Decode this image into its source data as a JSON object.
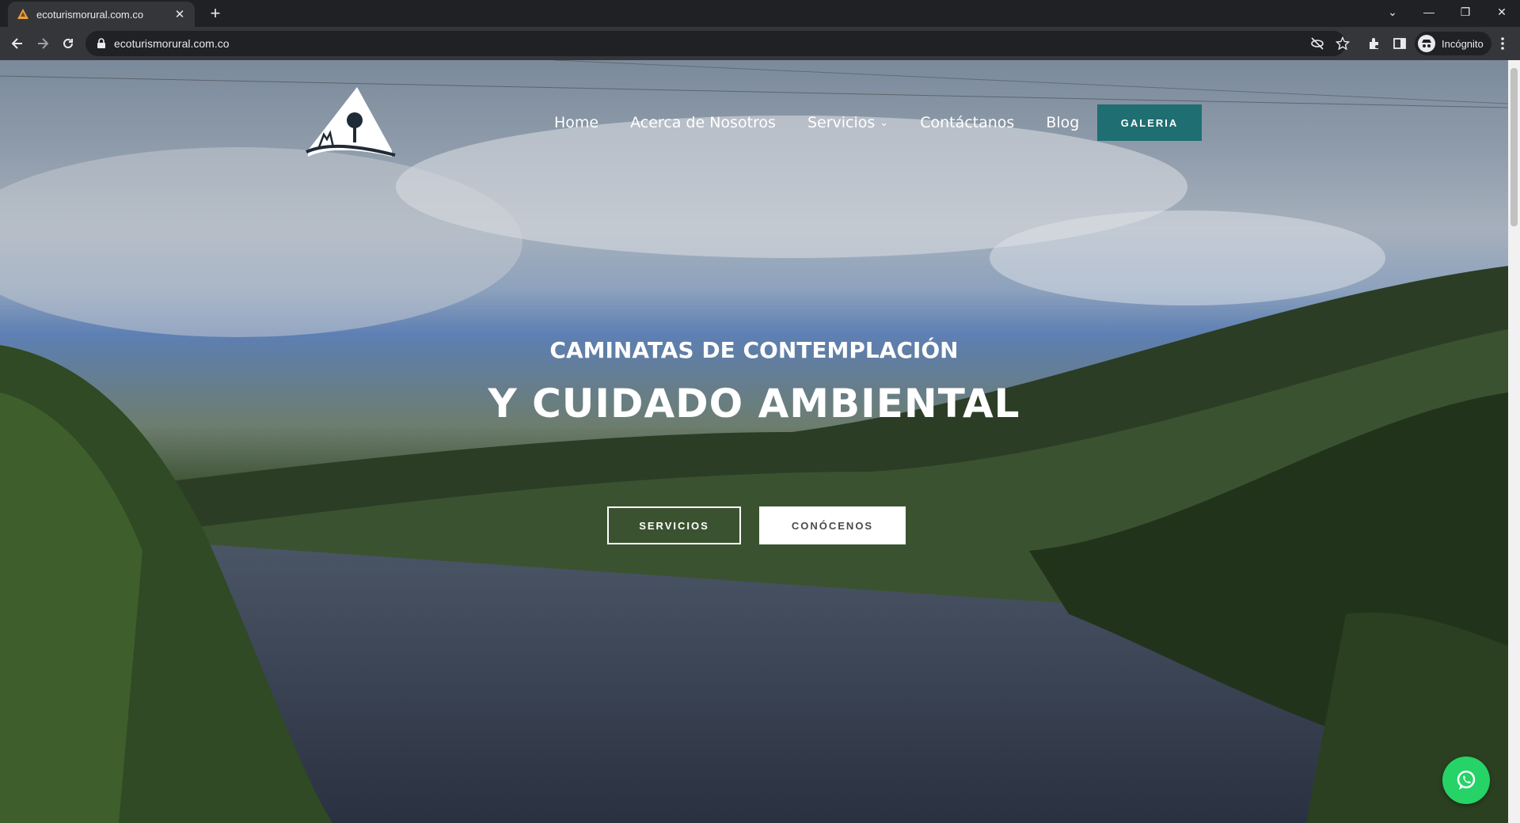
{
  "browser": {
    "tab_title": "ecoturismorural.com.co",
    "url": "ecoturismorural.com.co",
    "profile_label": "Incógnito"
  },
  "site": {
    "nav": {
      "home": "Home",
      "about": "Acerca de Nosotros",
      "services": "Servicios",
      "contact": "Contáctanos",
      "blog": "Blog",
      "gallery": "GALERIA"
    },
    "hero": {
      "subtitle": "CAMINATAS DE CONTEMPLACIÓN",
      "title": "Y CUIDADO AMBIENTAL",
      "btn_services": "SERVICIOS",
      "btn_about": "CONÓCENOS"
    }
  },
  "colors": {
    "accent": "#1e6e72",
    "whatsapp": "#25d366"
  },
  "icons": [
    "mountain-logo-icon",
    "whatsapp-icon",
    "lock-icon",
    "back-arrow-icon",
    "forward-arrow-icon",
    "reload-icon",
    "star-icon",
    "eye-off-icon",
    "extensions-icon",
    "sidepanel-icon",
    "incognito-icon",
    "menu-dots-icon"
  ]
}
